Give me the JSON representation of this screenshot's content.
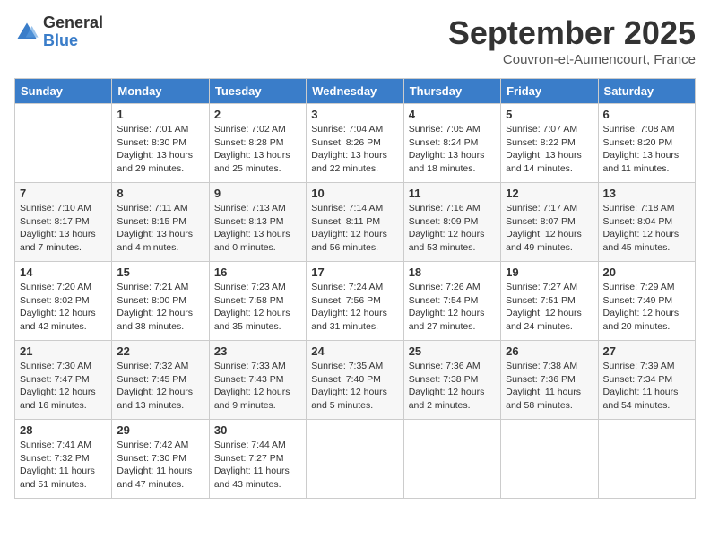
{
  "logo": {
    "general": "General",
    "blue": "Blue"
  },
  "title": "September 2025",
  "subtitle": "Couvron-et-Aumencourt, France",
  "days_of_week": [
    "Sunday",
    "Monday",
    "Tuesday",
    "Wednesday",
    "Thursday",
    "Friday",
    "Saturday"
  ],
  "weeks": [
    [
      {
        "day": "",
        "info": ""
      },
      {
        "day": "1",
        "info": "Sunrise: 7:01 AM\nSunset: 8:30 PM\nDaylight: 13 hours\nand 29 minutes."
      },
      {
        "day": "2",
        "info": "Sunrise: 7:02 AM\nSunset: 8:28 PM\nDaylight: 13 hours\nand 25 minutes."
      },
      {
        "day": "3",
        "info": "Sunrise: 7:04 AM\nSunset: 8:26 PM\nDaylight: 13 hours\nand 22 minutes."
      },
      {
        "day": "4",
        "info": "Sunrise: 7:05 AM\nSunset: 8:24 PM\nDaylight: 13 hours\nand 18 minutes."
      },
      {
        "day": "5",
        "info": "Sunrise: 7:07 AM\nSunset: 8:22 PM\nDaylight: 13 hours\nand 14 minutes."
      },
      {
        "day": "6",
        "info": "Sunrise: 7:08 AM\nSunset: 8:20 PM\nDaylight: 13 hours\nand 11 minutes."
      }
    ],
    [
      {
        "day": "7",
        "info": "Sunrise: 7:10 AM\nSunset: 8:17 PM\nDaylight: 13 hours\nand 7 minutes."
      },
      {
        "day": "8",
        "info": "Sunrise: 7:11 AM\nSunset: 8:15 PM\nDaylight: 13 hours\nand 4 minutes."
      },
      {
        "day": "9",
        "info": "Sunrise: 7:13 AM\nSunset: 8:13 PM\nDaylight: 13 hours\nand 0 minutes."
      },
      {
        "day": "10",
        "info": "Sunrise: 7:14 AM\nSunset: 8:11 PM\nDaylight: 12 hours\nand 56 minutes."
      },
      {
        "day": "11",
        "info": "Sunrise: 7:16 AM\nSunset: 8:09 PM\nDaylight: 12 hours\nand 53 minutes."
      },
      {
        "day": "12",
        "info": "Sunrise: 7:17 AM\nSunset: 8:07 PM\nDaylight: 12 hours\nand 49 minutes."
      },
      {
        "day": "13",
        "info": "Sunrise: 7:18 AM\nSunset: 8:04 PM\nDaylight: 12 hours\nand 45 minutes."
      }
    ],
    [
      {
        "day": "14",
        "info": "Sunrise: 7:20 AM\nSunset: 8:02 PM\nDaylight: 12 hours\nand 42 minutes."
      },
      {
        "day": "15",
        "info": "Sunrise: 7:21 AM\nSunset: 8:00 PM\nDaylight: 12 hours\nand 38 minutes."
      },
      {
        "day": "16",
        "info": "Sunrise: 7:23 AM\nSunset: 7:58 PM\nDaylight: 12 hours\nand 35 minutes."
      },
      {
        "day": "17",
        "info": "Sunrise: 7:24 AM\nSunset: 7:56 PM\nDaylight: 12 hours\nand 31 minutes."
      },
      {
        "day": "18",
        "info": "Sunrise: 7:26 AM\nSunset: 7:54 PM\nDaylight: 12 hours\nand 27 minutes."
      },
      {
        "day": "19",
        "info": "Sunrise: 7:27 AM\nSunset: 7:51 PM\nDaylight: 12 hours\nand 24 minutes."
      },
      {
        "day": "20",
        "info": "Sunrise: 7:29 AM\nSunset: 7:49 PM\nDaylight: 12 hours\nand 20 minutes."
      }
    ],
    [
      {
        "day": "21",
        "info": "Sunrise: 7:30 AM\nSunset: 7:47 PM\nDaylight: 12 hours\nand 16 minutes."
      },
      {
        "day": "22",
        "info": "Sunrise: 7:32 AM\nSunset: 7:45 PM\nDaylight: 12 hours\nand 13 minutes."
      },
      {
        "day": "23",
        "info": "Sunrise: 7:33 AM\nSunset: 7:43 PM\nDaylight: 12 hours\nand 9 minutes."
      },
      {
        "day": "24",
        "info": "Sunrise: 7:35 AM\nSunset: 7:40 PM\nDaylight: 12 hours\nand 5 minutes."
      },
      {
        "day": "25",
        "info": "Sunrise: 7:36 AM\nSunset: 7:38 PM\nDaylight: 12 hours\nand 2 minutes."
      },
      {
        "day": "26",
        "info": "Sunrise: 7:38 AM\nSunset: 7:36 PM\nDaylight: 11 hours\nand 58 minutes."
      },
      {
        "day": "27",
        "info": "Sunrise: 7:39 AM\nSunset: 7:34 PM\nDaylight: 11 hours\nand 54 minutes."
      }
    ],
    [
      {
        "day": "28",
        "info": "Sunrise: 7:41 AM\nSunset: 7:32 PM\nDaylight: 11 hours\nand 51 minutes."
      },
      {
        "day": "29",
        "info": "Sunrise: 7:42 AM\nSunset: 7:30 PM\nDaylight: 11 hours\nand 47 minutes."
      },
      {
        "day": "30",
        "info": "Sunrise: 7:44 AM\nSunset: 7:27 PM\nDaylight: 11 hours\nand 43 minutes."
      },
      {
        "day": "",
        "info": ""
      },
      {
        "day": "",
        "info": ""
      },
      {
        "day": "",
        "info": ""
      },
      {
        "day": "",
        "info": ""
      }
    ]
  ]
}
